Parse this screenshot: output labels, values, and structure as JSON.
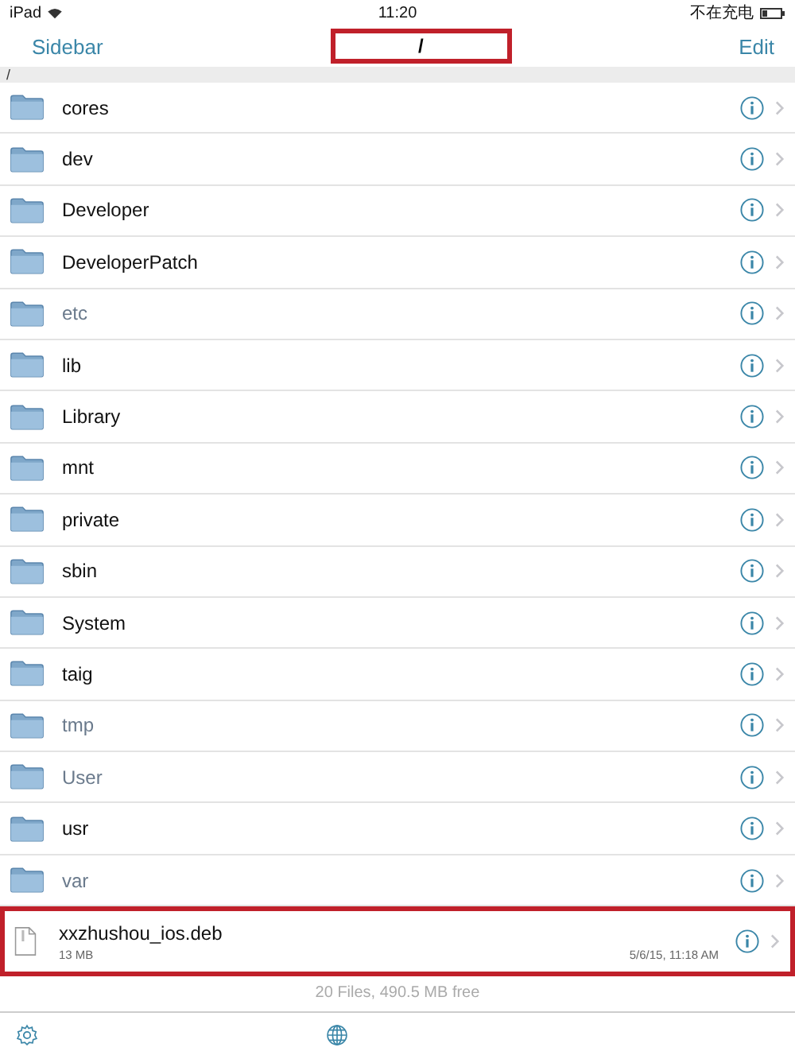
{
  "status_bar": {
    "device": "iPad",
    "time": "11:20",
    "battery_text": "不在充电"
  },
  "nav_bar": {
    "back": "Sidebar",
    "title": "/",
    "title_highlighted": true,
    "action": "Edit"
  },
  "path": "/",
  "items": [
    {
      "kind": "folder",
      "name": "cores",
      "dimmed": false
    },
    {
      "kind": "folder",
      "name": "dev",
      "dimmed": false
    },
    {
      "kind": "folder",
      "name": "Developer",
      "dimmed": false
    },
    {
      "kind": "folder",
      "name": "DeveloperPatch",
      "dimmed": false
    },
    {
      "kind": "folder",
      "name": "etc",
      "dimmed": true
    },
    {
      "kind": "folder",
      "name": "lib",
      "dimmed": false
    },
    {
      "kind": "folder",
      "name": "Library",
      "dimmed": false
    },
    {
      "kind": "folder",
      "name": "mnt",
      "dimmed": false
    },
    {
      "kind": "folder",
      "name": "private",
      "dimmed": false
    },
    {
      "kind": "folder",
      "name": "sbin",
      "dimmed": false
    },
    {
      "kind": "folder",
      "name": "System",
      "dimmed": false
    },
    {
      "kind": "folder",
      "name": "taig",
      "dimmed": false
    },
    {
      "kind": "folder",
      "name": "tmp",
      "dimmed": true
    },
    {
      "kind": "folder",
      "name": "User",
      "dimmed": true
    },
    {
      "kind": "folder",
      "name": "usr",
      "dimmed": false
    },
    {
      "kind": "folder",
      "name": "var",
      "dimmed": true
    },
    {
      "kind": "file",
      "name": "xxzhushou_ios.deb",
      "size": "13 MB",
      "date": "5/6/15, 11:18 AM",
      "highlighted": true
    }
  ],
  "footer": "20 Files, 490.5 MB free"
}
